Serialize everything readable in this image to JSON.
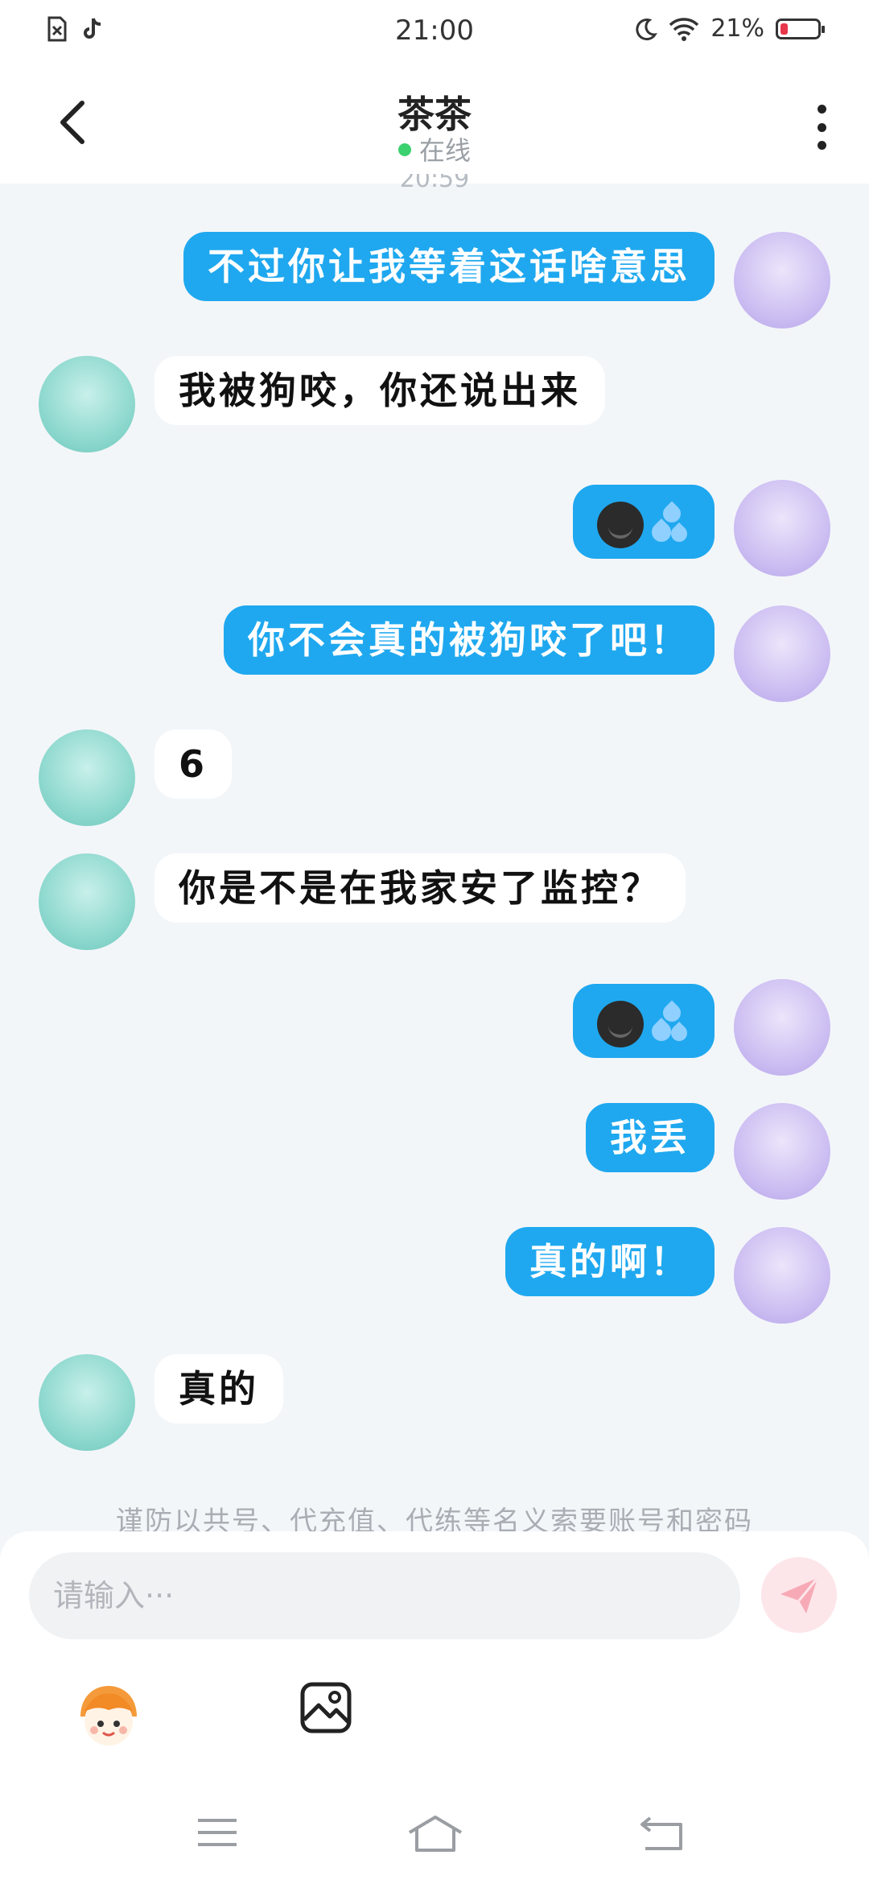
{
  "status_bar": {
    "time": "21:00",
    "battery": "21%",
    "battery_level": 0.21,
    "icons_left": [
      "sim-off-icon",
      "tiktok-icon"
    ],
    "icons_right": [
      "moon-icon",
      "wifi-icon",
      "battery-icon"
    ]
  },
  "header": {
    "title": "茶茶",
    "status": "在线",
    "status_color": "#3bd16f"
  },
  "chat": {
    "clipped_time": "20:59",
    "messages": [
      {
        "side": "self",
        "text": "不过你让我等着这话啥意思"
      },
      {
        "side": "other",
        "text": "我被狗咬，你还说出来"
      },
      {
        "side": "self",
        "emoji": [
          "smirking-dark-face-emoji",
          "sweat-droplets-emoji"
        ]
      },
      {
        "side": "self",
        "text": "你不会真的被狗咬了吧！"
      },
      {
        "side": "other",
        "text": "6"
      },
      {
        "side": "other",
        "text": "你是不是在我家安了监控？"
      },
      {
        "side": "self",
        "emoji": [
          "smirking-dark-face-emoji",
          "sweat-droplets-emoji"
        ]
      },
      {
        "side": "self",
        "text": "我丢"
      },
      {
        "side": "self",
        "text": "真的啊！"
      },
      {
        "side": "other",
        "text": "真的"
      }
    ]
  },
  "notice": "谨防以共号、代充值、代练等名义索要账号和密码",
  "input": {
    "placeholder": "请输入···"
  },
  "colors": {
    "self_bubble": "#1fa8ef",
    "other_bubble": "#ffffff",
    "background": "#f3f6f9"
  }
}
